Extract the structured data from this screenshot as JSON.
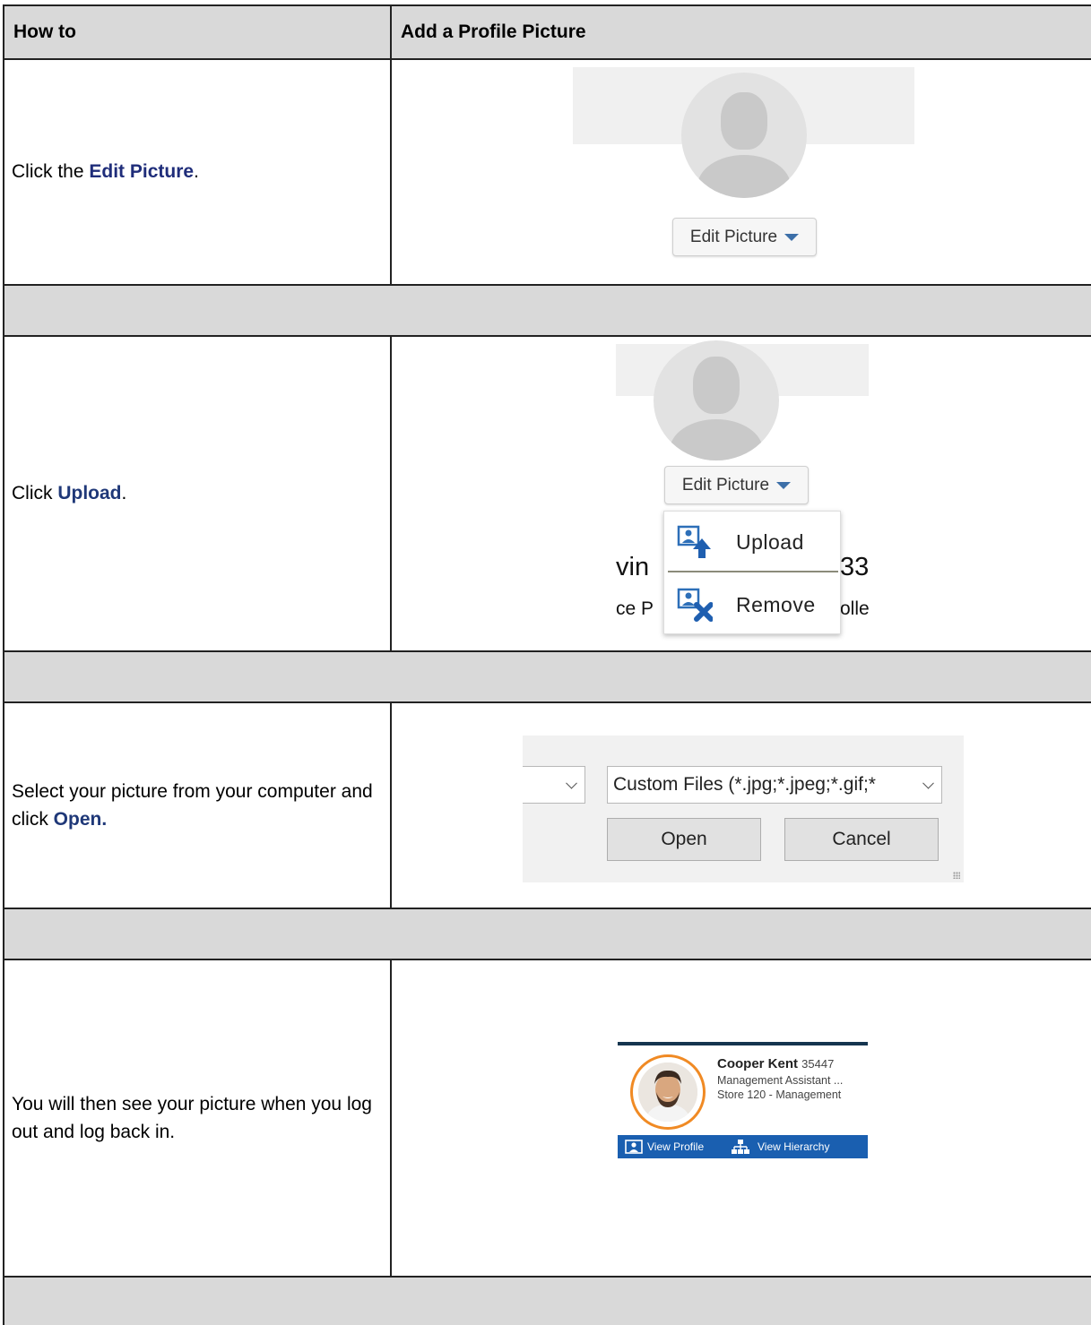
{
  "header": {
    "col1": "How to",
    "col2": "Add a Profile Picture"
  },
  "steps": [
    {
      "pre": "Click the ",
      "highlight": "Edit Picture",
      "post": "."
    },
    {
      "pre": "Click ",
      "highlight": "Upload",
      "post": "."
    },
    {
      "pre": "Select your picture from your computer and click ",
      "highlight": "Open.",
      "post": ""
    },
    {
      "text": "You will then see your picture when you log out and log back in."
    }
  ],
  "shot1": {
    "edit_label": "Edit Picture"
  },
  "shot2": {
    "edit_label": "Edit Picture",
    "menu": [
      "Upload",
      "Remove"
    ],
    "behind": {
      "a": "vin",
      "b": "33",
      "c": "ce P",
      "d": "olle"
    }
  },
  "shot3": {
    "filter": "Custom Files (*.jpg;*.jpeg;*.gif;*",
    "open": "Open",
    "cancel": "Cancel"
  },
  "shot4": {
    "name": "Cooper Kent",
    "id": "35447",
    "title": "Management Assistant ...",
    "store": "Store 120 - Management",
    "view_profile": "View Profile",
    "view_hierarchy": "View Hierarchy"
  },
  "colors": {
    "highlight": "#1f2d7a",
    "header_bg": "#d9d9d9",
    "accent": "#1a5fb0",
    "ring": "#f08a24"
  }
}
